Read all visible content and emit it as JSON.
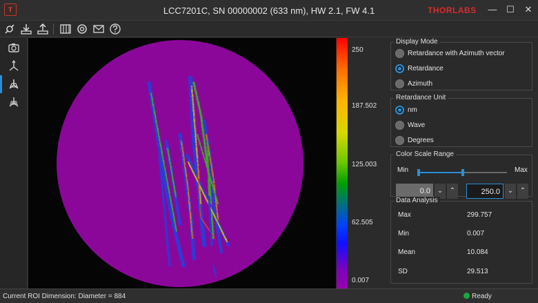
{
  "window": {
    "title": "LCC7201C, SN 00000002 (633 nm), HW 2.1, FW 4.1",
    "brand": "THORLABS",
    "minimize_glyph": "—",
    "maximize_glyph": "☐",
    "close_glyph": "✕"
  },
  "toolbar": {
    "icons": [
      "settings-icon",
      "download-icon",
      "upload-icon",
      "grid-icon",
      "refresh-icon",
      "mail-icon",
      "help-icon"
    ]
  },
  "sidebar": {
    "items": [
      "camera-icon",
      "axes-icon",
      "axes-selected-icon",
      "axes-multi-icon"
    ],
    "active_index": 2
  },
  "colorbar": {
    "ticks": [
      "250",
      "187.502",
      "125.003",
      "62.505",
      "0.007"
    ]
  },
  "display_mode": {
    "title": "Display Mode",
    "options": [
      "Retardance with Azimuth vector",
      "Retardance",
      "Azimuth"
    ],
    "selected": 1
  },
  "retardance_unit": {
    "title": "Retardance Unit",
    "options": [
      "nm",
      "Wave",
      "Degrees"
    ],
    "selected": 0
  },
  "color_scale": {
    "title": "Color Scale Range",
    "min_label": "Min",
    "max_label": "Max",
    "min_value": "0.0",
    "max_value": "250.0",
    "slider_min_fraction": 0.0,
    "slider_max_fraction": 0.5
  },
  "data_analysis": {
    "title": "Data Analysis",
    "rows": [
      {
        "label": "Max",
        "value": "299.757"
      },
      {
        "label": "Min",
        "value": "0.007"
      },
      {
        "label": "Mean",
        "value": "10.084"
      },
      {
        "label": "SD",
        "value": "29.513"
      }
    ]
  },
  "status": {
    "left": "Current ROI Dimension: Diameter = 884",
    "right": "Ready",
    "ready_color": "#19a83b"
  },
  "colors": {
    "accent": "#2b8fd6",
    "roi_fill": "#8b079a",
    "brand": "#d92b2b"
  }
}
